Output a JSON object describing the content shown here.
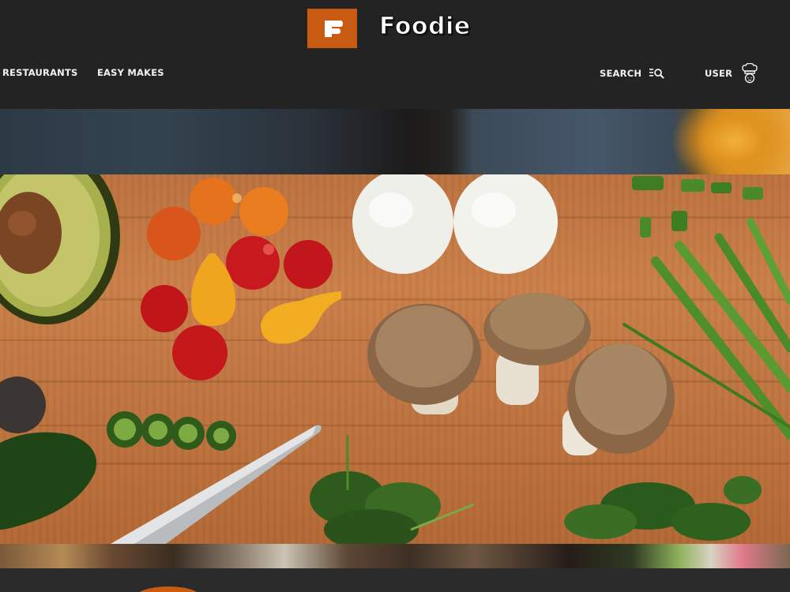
{
  "brand": {
    "name": "Foodie",
    "logo_letter": "F",
    "accent_color": "#c85a12"
  },
  "nav": {
    "restaurants_label": "RESTAURANTS",
    "easy_makes_label": "EASY MAKES"
  },
  "header_actions": {
    "search_label": "SEARCH",
    "search_icon": "search-icon",
    "user_label": "USER",
    "user_icon": "chef-hat-icon"
  },
  "hero": {
    "image": "cutting-board-vegetables-photo"
  }
}
